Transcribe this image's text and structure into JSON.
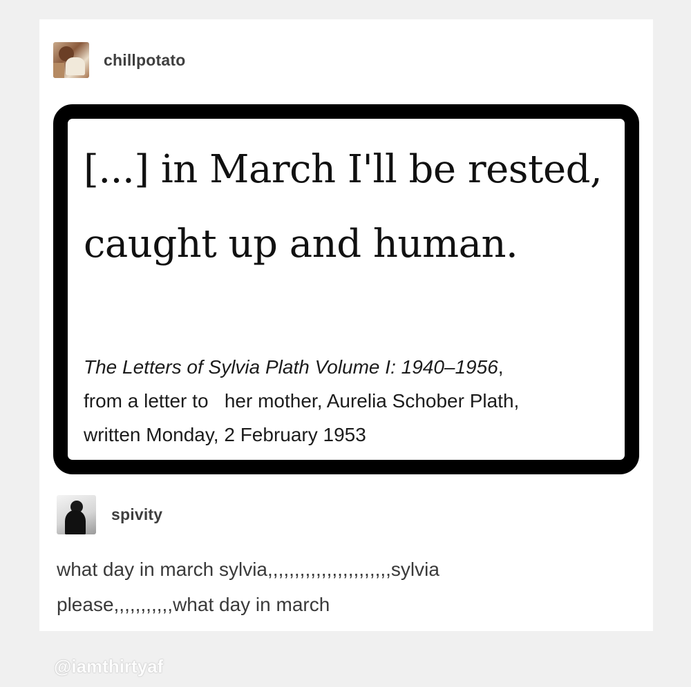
{
  "post": {
    "author": {
      "username": "chillpotato",
      "avatar": "avatar-photo"
    },
    "quote": {
      "text": "[...] in March I'll be rested, caught up and human.",
      "citation_book": "The Letters of Sylvia Plath Volume I: 1940–1956",
      "citation_rest_1": ",",
      "citation_rest_2": "from a letter to   her mother, Aurelia Schober Plath,",
      "citation_rest_3": "written Monday, 2 February 1953"
    }
  },
  "reply": {
    "author": {
      "username": "spivity",
      "avatar": "avatar-photo"
    },
    "text_line_1": "what day in march sylvia,,,,,,,,,,,,,,,,,,,,,,,sylvia",
    "text_line_2": "please,,,,,,,,,,,what day in march"
  },
  "watermark": "@iamthirtyaf",
  "colors": {
    "background": "#f0f0f0",
    "card": "#ffffff",
    "quote_border": "#000000",
    "username": "#3f3f3f"
  }
}
